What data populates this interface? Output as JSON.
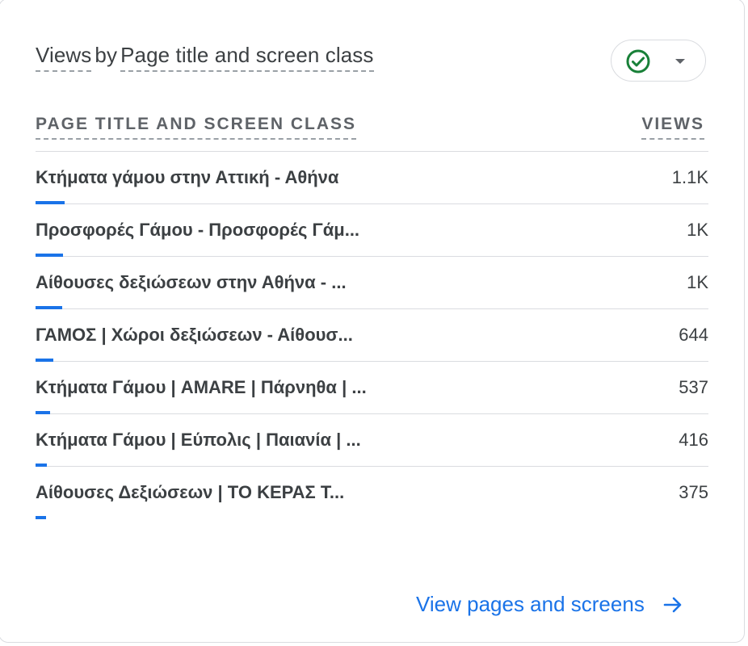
{
  "card": {
    "title_part1": "Views",
    "title_sep": "by",
    "title_part2": "Page title and screen class",
    "status_color": "#188038",
    "columns": {
      "dimension": "PAGE TITLE AND SCREEN CLASS",
      "metric": "VIEWS"
    },
    "rows": [
      {
        "name": "Κτήματα γάμου στην Αττική - Αθήνα",
        "value": "1.1K",
        "share": 1.0
      },
      {
        "name": "Προσφορές Γάμου - Προσφορές Γάμ...",
        "value": "1K",
        "share": 0.95
      },
      {
        "name": "Αίθουσες δεξιώσεων στην Αθήνα - ...",
        "value": "1K",
        "share": 0.93
      },
      {
        "name": "ΓΑΜΟΣ | Χώροι δεξιώσεων - Αίθουσ...",
        "value": "644",
        "share": 0.61
      },
      {
        "name": "Κτήματα Γάμου | AMARE | Πάρνηθα | ...",
        "value": "537",
        "share": 0.51
      },
      {
        "name": "Κτήματα Γάμου | Εύπολις | Παιανία | ...",
        "value": "416",
        "share": 0.39
      },
      {
        "name": "Αίθουσες Δεξιώσεων | ΤΟ ΚΕΡΑΣ Τ...",
        "value": "375",
        "share": 0.36
      }
    ],
    "footer_link": "View pages and screens",
    "accent_color": "#1a73e8"
  }
}
